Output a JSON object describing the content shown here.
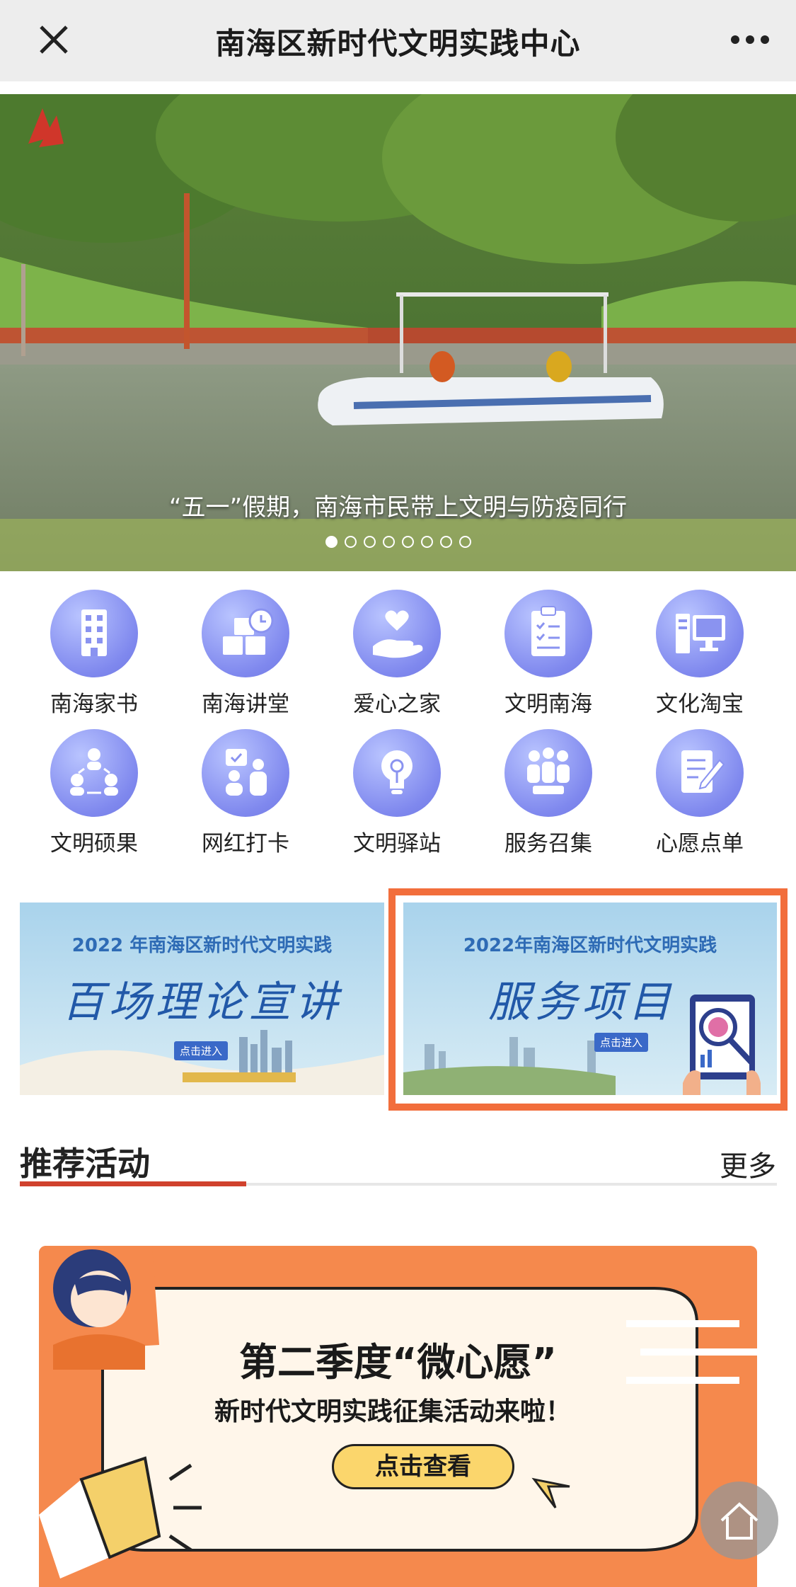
{
  "header": {
    "title": "南海区新时代文明实践中心",
    "close_icon": "close-icon",
    "more_icon": "more-dots-icon"
  },
  "banner": {
    "caption": "“五一”假期，南海市民带上文明与防疫同行",
    "slide_count": 8,
    "active_slide": 1
  },
  "grid": {
    "items": [
      {
        "label": "南海家书",
        "icon": "building-icon"
      },
      {
        "label": "南海讲堂",
        "icon": "schedule-blocks-icon"
      },
      {
        "label": "爱心之家",
        "icon": "heart-hand-icon"
      },
      {
        "label": "文明南海",
        "icon": "clipboard-check-icon"
      },
      {
        "label": "文化淘宝",
        "icon": "computer-icon"
      },
      {
        "label": "文明硕果",
        "icon": "team-circle-icon"
      },
      {
        "label": "网红打卡",
        "icon": "checkin-people-icon"
      },
      {
        "label": "文明驿站",
        "icon": "lightbulb-icon"
      },
      {
        "label": "服务召集",
        "icon": "group-meeting-icon"
      },
      {
        "label": "心愿点单",
        "icon": "note-pen-icon"
      }
    ]
  },
  "promos": [
    {
      "line1": "2022 年南海区新时代文明实践",
      "line2": "百场理论宣讲",
      "enter": "点击进入"
    },
    {
      "line1": "2022年南海区新时代文明实践",
      "line2": "服务项目",
      "enter": "点击进入"
    }
  ],
  "section": {
    "title": "推荐活动",
    "more": "更多"
  },
  "activity": {
    "title": "第二季度“微心愿”",
    "subtitle": "新时代文明实践征集活动来啦！",
    "button": "点击查看"
  },
  "home_icon": "home-icon",
  "colors": {
    "accent": "#d0412d",
    "highlight_frame": "#f26e3c",
    "icon_purple": "#7f88ee",
    "promo_blue": "#2158a8",
    "card_orange": "#f5894d"
  }
}
